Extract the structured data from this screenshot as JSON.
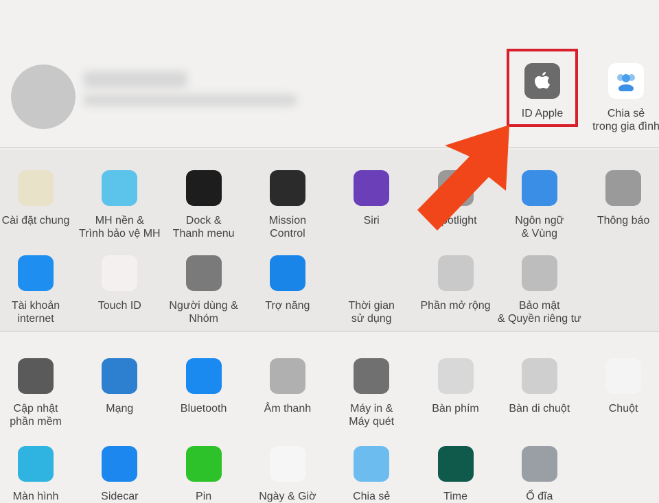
{
  "header": {
    "apple_id": {
      "label": "ID Apple",
      "icon": "apple-icon"
    },
    "family": {
      "label1": "Chia sẻ",
      "label2": "trong gia đình",
      "icon": "family-icon"
    }
  },
  "rows": [
    [
      {
        "l1": "Cài đặt chung",
        "l2": "",
        "icon": "general-icon",
        "c": "#e8e3c8"
      },
      {
        "l1": "MH nền &",
        "l2": "Trình bảo vệ MH",
        "icon": "desktop-icon",
        "c": "#5cc3ea"
      },
      {
        "l1": "Dock &",
        "l2": "Thanh menu",
        "icon": "dock-icon",
        "c": "#1d1d1d"
      },
      {
        "l1": "Mission",
        "l2": "Control",
        "icon": "mission-control-icon",
        "c": "#2b2b2b"
      },
      {
        "l1": "Siri",
        "l2": "",
        "icon": "siri-icon",
        "c": "#6a3fb8"
      },
      {
        "l1": "Spotlight",
        "l2": "",
        "icon": "spotlight-icon",
        "c": "#999999"
      },
      {
        "l1": "Ngôn ngữ",
        "l2": "& Vùng",
        "icon": "globe-flag-icon",
        "c": "#3b8ee6"
      },
      {
        "l1": "Thông báo",
        "l2": "",
        "icon": "bell-icon",
        "c": "#9a9a9a"
      }
    ],
    [
      {
        "l1": "Tài khoản",
        "l2": "internet",
        "icon": "at-icon",
        "c": "#1e8ff0"
      },
      {
        "l1": "Touch ID",
        "l2": "",
        "icon": "fingerprint-icon",
        "c": "#f4f0f0"
      },
      {
        "l1": "Người dùng &",
        "l2": "Nhóm",
        "icon": "users-icon",
        "c": "#7a7a7a"
      },
      {
        "l1": "Trợ năng",
        "l2": "",
        "icon": "accessibility-icon",
        "c": "#1a85e8"
      },
      {
        "l1": "Thời gian",
        "l2": "sử dụng",
        "icon": "hourglass-icon",
        "c": "#e9e8e7"
      },
      {
        "l1": "Phần mở rộng",
        "l2": "",
        "icon": "puzzle-icon",
        "c": "#c9c9c9"
      },
      {
        "l1": "Bảo mật",
        "l2": "& Quyền riêng tư",
        "icon": "house-lock-icon",
        "c": "#bdbdbd"
      },
      {
        "l1": "",
        "l2": "",
        "icon": "",
        "c": ""
      }
    ],
    [
      {
        "l1": "Cập nhật",
        "l2": "phần mềm",
        "icon": "gear-icon",
        "c": "#5a5a5a"
      },
      {
        "l1": "Mạng",
        "l2": "",
        "icon": "network-globe-icon",
        "c": "#2d7fd0"
      },
      {
        "l1": "Bluetooth",
        "l2": "",
        "icon": "bluetooth-icon",
        "c": "#1a8af0"
      },
      {
        "l1": "Âm thanh",
        "l2": "",
        "icon": "speaker-icon",
        "c": "#b0b0b0"
      },
      {
        "l1": "Máy in &",
        "l2": "Máy quét",
        "icon": "printer-icon",
        "c": "#707070"
      },
      {
        "l1": "Bàn phím",
        "l2": "",
        "icon": "keyboard-icon",
        "c": "#d8d8d8"
      },
      {
        "l1": "Bàn di chuột",
        "l2": "",
        "icon": "trackpad-icon",
        "c": "#cfcfcf"
      },
      {
        "l1": "Chuột",
        "l2": "",
        "icon": "mouse-icon",
        "c": "#f4f4f4"
      }
    ],
    [
      {
        "l1": "Màn hình",
        "l2": "",
        "icon": "display-icon",
        "c": "#2fb3e0"
      },
      {
        "l1": "Sidecar",
        "l2": "",
        "icon": "sidecar-icon",
        "c": "#1c87ee"
      },
      {
        "l1": "Pin",
        "l2": "",
        "icon": "battery-icon",
        "c": "#2ec22a"
      },
      {
        "l1": "Ngày & Giờ",
        "l2": "",
        "icon": "clock-icon",
        "c": "#f6f6f6"
      },
      {
        "l1": "Chia sẻ",
        "l2": "",
        "icon": "shared-folder-icon",
        "c": "#6cbcf0"
      },
      {
        "l1": "Time",
        "l2": "",
        "icon": "time-machine-icon",
        "c": "#0f5a4a"
      },
      {
        "l1": "Ổ đĩa",
        "l2": "",
        "icon": "disk-icon",
        "c": "#9a9fa6"
      },
      {
        "l1": "",
        "l2": "",
        "icon": "",
        "c": ""
      }
    ]
  ],
  "colors": {
    "highlight": "#d8202c",
    "arrow": "#f0461a"
  }
}
